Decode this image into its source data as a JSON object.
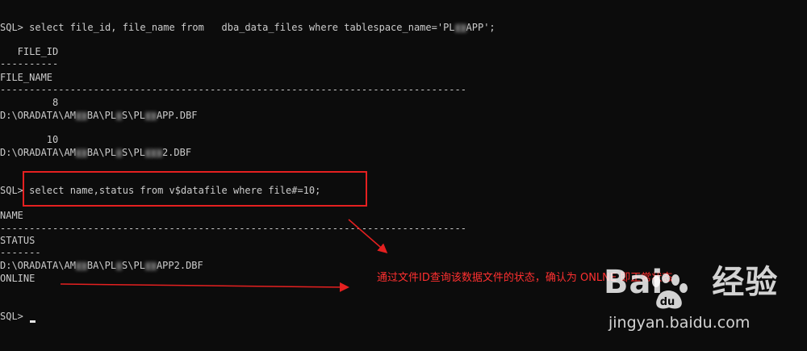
{
  "terminal": {
    "lines": [
      "SQL> select file_id, file_name from   dba_data_files where tablespace_name='PL██APP';",
      "",
      "   FILE_ID",
      "----------",
      "FILE_NAME",
      "--------------------------------------------------------------------------------",
      "         8",
      "D:\\ORADATA\\AM██BA\\PL█S\\PL██APP.DBF",
      "",
      "        10",
      "D:\\ORADATA\\AM██BA\\PL█S\\PL███2.DBF",
      "",
      "",
      "SQL> select name,status from v$datafile where file#=10;",
      "",
      "NAME",
      "--------------------------------------------------------------------------------",
      "STATUS",
      "-------",
      "D:\\ORADATA\\AM██BA\\PL█S\\PL██APP2.DBF",
      "ONLINE",
      "",
      "",
      "SQL> "
    ]
  },
  "annotation": {
    "text": "通过文件ID查询该数据文件的状态，确认为 ONLNE 即正常状态",
    "color": "#ff3030"
  },
  "highlight_color": "#e52020",
  "watermark": {
    "logo_left": "Bai",
    "logo_right": "经验",
    "url": "jingyan.baidu.com"
  }
}
